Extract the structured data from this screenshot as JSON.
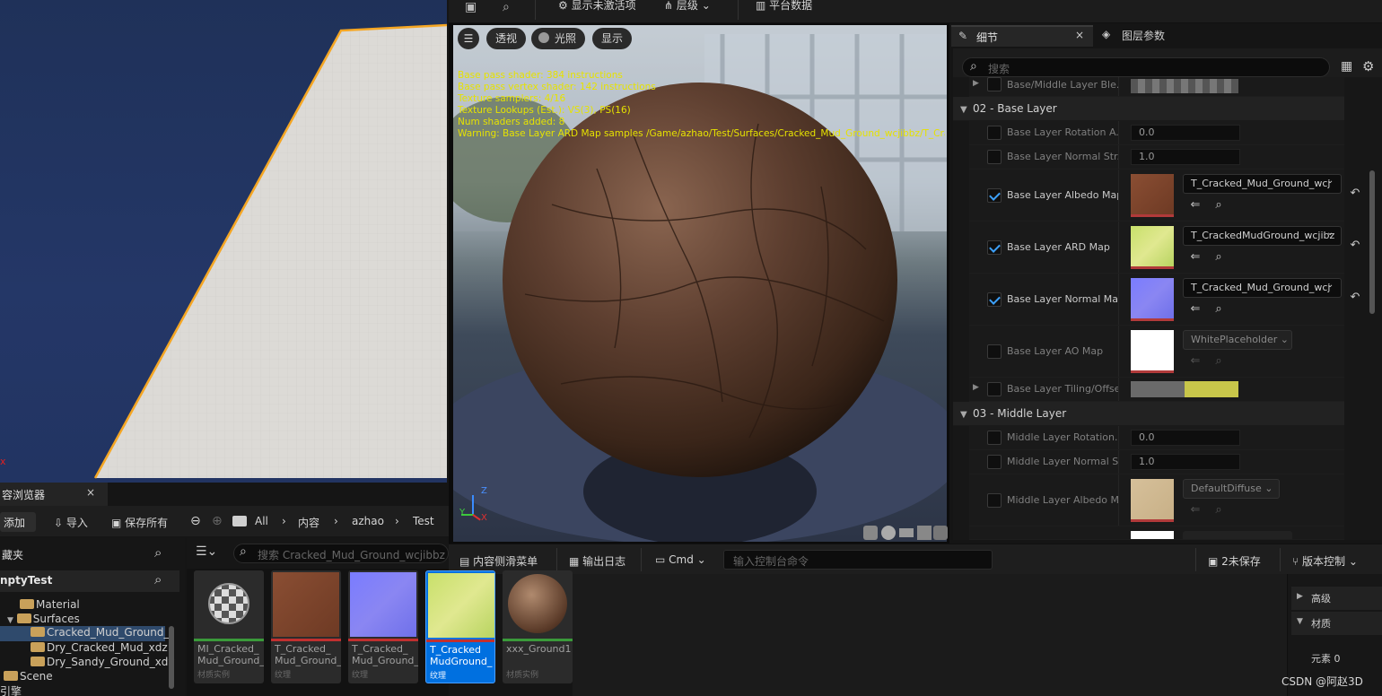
{
  "viewport_left": {
    "axis_x": "x"
  },
  "top_toolbar": {
    "show_inactive": "显示未激活项",
    "layers": "层级",
    "platform_data": "平台数据"
  },
  "preview": {
    "view_modes": [
      "透视",
      "光照",
      "显示"
    ],
    "stats": [
      "Base pass shader: 384 instructions",
      "Base pass vertex shader: 142 instructions",
      "Texture samplers: 4/16",
      "Texture Lookups (Est.): VS(3), PS(16)",
      "Num shaders added: 8",
      "Warning: Base Layer ARD Map samples /Game/azhao/Test/Surfaces/Cracked_Mud_Ground_wcjibbz/T_Cracke"
    ],
    "gizmo": {
      "z": "Z",
      "y": "Y",
      "x": "X"
    }
  },
  "details": {
    "tab_details": "细节",
    "tab_layer_params": "图层参数",
    "search_placeholder": "搜索",
    "partial_row_label": "Base/Middle Layer Ble...",
    "section_base": "02 - Base Layer",
    "section_middle": "03 - Middle Layer",
    "base_rows": {
      "rotation": {
        "label": "Base Layer Rotation A...",
        "value": "0.0"
      },
      "normal_strength": {
        "label": "Base Layer Normal Str...",
        "value": "1.0"
      },
      "albedo": {
        "label": "Base Layer Albedo Map",
        "texture": "T_Cracked_Mud_Ground_wcj"
      },
      "ard": {
        "label": "Base Layer ARD Map",
        "texture": "T_CrackedMudGround_wcjibz"
      },
      "normal": {
        "label": "Base Layer Normal Map",
        "texture": "T_Cracked_Mud_Ground_wcj"
      },
      "ao": {
        "label": "Base Layer AO Map",
        "texture": "WhitePlaceholder"
      },
      "tiling": {
        "label": "Base Layer Tiling/Offset"
      }
    },
    "middle_rows": {
      "rotation": {
        "label": "Middle Layer Rotation...",
        "value": "0.0"
      },
      "normal_strength": {
        "label": "Middle Layer Normal S...",
        "value": "1.0"
      },
      "albedo": {
        "label": "Middle Layer Albedo M...",
        "texture": "DefaultDiffuse"
      }
    }
  },
  "content_browser": {
    "tab_title": "容浏览器",
    "add": "添加",
    "import": "导入",
    "save_all": "保存所有",
    "breadcrumb": [
      "All",
      "内容",
      "azhao",
      "Test"
    ],
    "favorites": "藏夹",
    "project": "nptyTest",
    "search_placeholder": "搜索 Cracked_Mud_Ground_wcjibbz",
    "tree": {
      "material": "Material",
      "surfaces": "Surfaces",
      "cracked": "Cracked_Mud_Ground_",
      "dry_cracked": "Dry_Cracked_Mud_xdz",
      "dry_sandy": "Dry_Sandy_Ground_xdy",
      "scene": "Scene",
      "engine": "引擎"
    },
    "assets": [
      {
        "name": "MI_Cracked_ Mud_Ground_",
        "type": "材质实例"
      },
      {
        "name": "T_Cracked_ Mud_Ground_",
        "type": "纹理"
      },
      {
        "name": "T_Cracked_ Mud_Ground_",
        "type": "纹理"
      },
      {
        "name": "T_Cracked MudGround_",
        "type": "纹理"
      },
      {
        "name": "xxx_Ground1",
        "type": "材质实例"
      }
    ]
  },
  "bottom_bar": {
    "content_drawer": "内容侧滑菜单",
    "output_log": "输出日志",
    "cmd": "Cmd",
    "cmd_placeholder": "输入控制台命令",
    "unsaved": "2未保存",
    "version_control": "版本控制"
  },
  "right_panel": {
    "advanced": "高级",
    "material": "材质",
    "element": "元素 0"
  },
  "watermark": "CSDN @阿赵3D",
  "colors": {
    "accent_blue": "#0070e0",
    "selection_orange": "#f5a623",
    "check_blue": "#3da1ff",
    "panel_bg": "#1a1a1a"
  }
}
